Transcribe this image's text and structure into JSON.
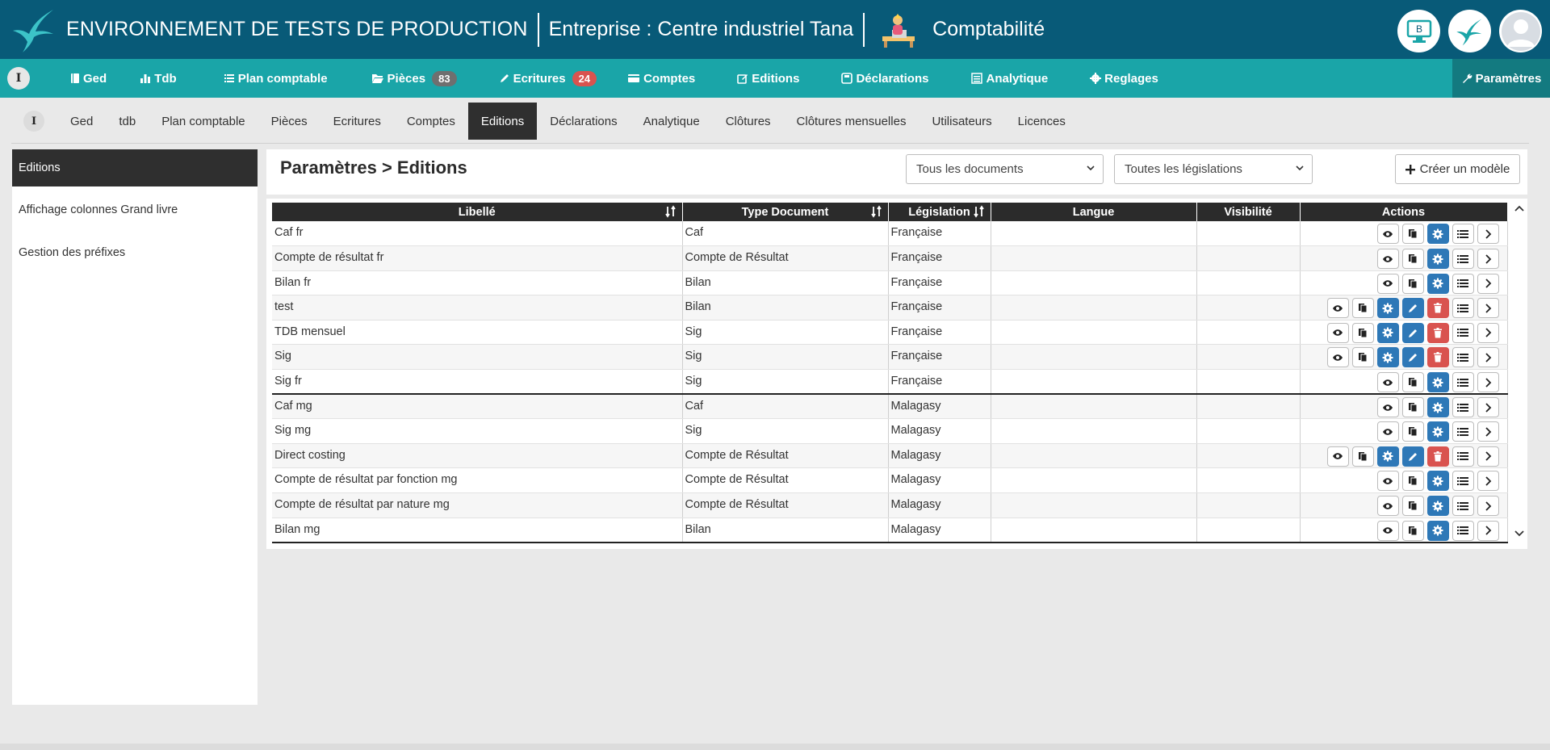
{
  "header": {
    "env_title": "ENVIRONNEMENT DE TESTS DE PRODUCTION",
    "company": "Entreprise : Centre industriel Tana",
    "module": "Comptabilité",
    "avatar_b_letter": "B"
  },
  "main_nav": {
    "info": "I",
    "items": [
      {
        "label": "Ged",
        "icon": "book-icon"
      },
      {
        "label": "Tdb",
        "icon": "bar-chart-icon"
      },
      {
        "label": "Plan comptable",
        "icon": "list-icon"
      },
      {
        "label": "Pièces",
        "icon": "folder-open-icon",
        "badge": "83"
      },
      {
        "label": "Ecritures",
        "icon": "pencil-icon",
        "badge": "24"
      },
      {
        "label": "Comptes",
        "icon": "card-icon"
      },
      {
        "label": "Editions",
        "icon": "edit-icon"
      },
      {
        "label": "Déclarations",
        "icon": "save-icon"
      },
      {
        "label": "Analytique",
        "icon": "doc-list-icon"
      },
      {
        "label": "Reglages",
        "icon": "gear-icon"
      }
    ],
    "params": "Paramètres"
  },
  "sub_nav": {
    "info": "I",
    "items": [
      "Ged",
      "tdb",
      "Plan comptable",
      "Pièces",
      "Ecritures",
      "Comptes",
      "Editions",
      "Déclarations",
      "Analytique",
      "Clôtures",
      "Clôtures mensuelles",
      "Utilisateurs",
      "Licences"
    ],
    "active": "Editions"
  },
  "sidebar": {
    "items": [
      "Editions",
      "Affichage colonnes Grand livre",
      "Gestion des préfixes"
    ]
  },
  "panel": {
    "title": "Paramètres > Editions",
    "filter_documents": "Tous les documents",
    "filter_legislations": "Toutes les législations",
    "create_label": "Créer un modèle"
  },
  "table": {
    "headers": [
      "Libellé",
      "Type Document",
      "Législation",
      "Langue",
      "Visibilité",
      "Actions"
    ],
    "rows": [
      {
        "libelle": "Caf fr",
        "type": "Caf",
        "legislation": "Française",
        "langue": "",
        "visibilite": "",
        "editable": false
      },
      {
        "libelle": "Compte de résultat fr",
        "type": "Compte de Résultat",
        "legislation": "Française",
        "langue": "",
        "visibilite": "",
        "editable": false
      },
      {
        "libelle": "Bilan fr",
        "type": "Bilan",
        "legislation": "Française",
        "langue": "",
        "visibilite": "",
        "editable": false
      },
      {
        "libelle": "test",
        "type": "Bilan",
        "legislation": "Française",
        "langue": "",
        "visibilite": "",
        "editable": true
      },
      {
        "libelle": "TDB mensuel",
        "type": "Sig",
        "legislation": "Française",
        "langue": "",
        "visibilite": "",
        "editable": true
      },
      {
        "libelle": "Sig",
        "type": "Sig",
        "legislation": "Française",
        "langue": "",
        "visibilite": "",
        "editable": true
      },
      {
        "libelle": "Sig fr",
        "type": "Sig",
        "legislation": "Française",
        "langue": "",
        "visibilite": "",
        "editable": false
      },
      {
        "libelle": "Caf mg",
        "type": "Caf",
        "legislation": "Malagasy",
        "langue": "",
        "visibilite": "",
        "editable": false
      },
      {
        "libelle": "Sig mg",
        "type": "Sig",
        "legislation": "Malagasy",
        "langue": "",
        "visibilite": "",
        "editable": false
      },
      {
        "libelle": "Direct costing",
        "type": "Compte de Résultat",
        "legislation": "Malagasy",
        "langue": "",
        "visibilite": "",
        "editable": true
      },
      {
        "libelle": "Compte de résultat par fonction mg",
        "type": "Compte de Résultat",
        "legislation": "Malagasy",
        "langue": "",
        "visibilite": "",
        "editable": false
      },
      {
        "libelle": "Compte de résultat par nature mg",
        "type": "Compte de Résultat",
        "legislation": "Malagasy",
        "langue": "",
        "visibilite": "",
        "editable": false
      },
      {
        "libelle": "Bilan mg",
        "type": "Bilan",
        "legislation": "Malagasy",
        "langue": "",
        "visibilite": "",
        "editable": false
      }
    ]
  },
  "colors": {
    "header_bg": "#085a78",
    "nav_bg": "#1aa5a8",
    "accent_blue": "#2e78b7",
    "danger_red": "#d9534f",
    "dark": "#2f2f2f"
  }
}
